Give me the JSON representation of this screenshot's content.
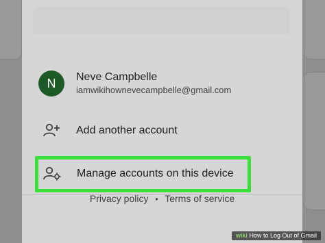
{
  "account": {
    "initial": "N",
    "name": "Neve Campbelle",
    "email": "iamwikihownevecampbelle@gmail.com"
  },
  "menu": {
    "add_account": "Add another account",
    "manage_accounts": "Manage accounts on this device"
  },
  "footer": {
    "privacy": "Privacy policy",
    "separator": "•",
    "terms": "Terms of service"
  },
  "watermark": {
    "brand": "wiki",
    "title": "How to Log Out of Gmail"
  },
  "colors": {
    "avatar": "#1e5a28",
    "highlight": "#39e039"
  },
  "icons": {
    "add_account": "person-add-icon",
    "manage_accounts": "manage-accounts-icon"
  }
}
